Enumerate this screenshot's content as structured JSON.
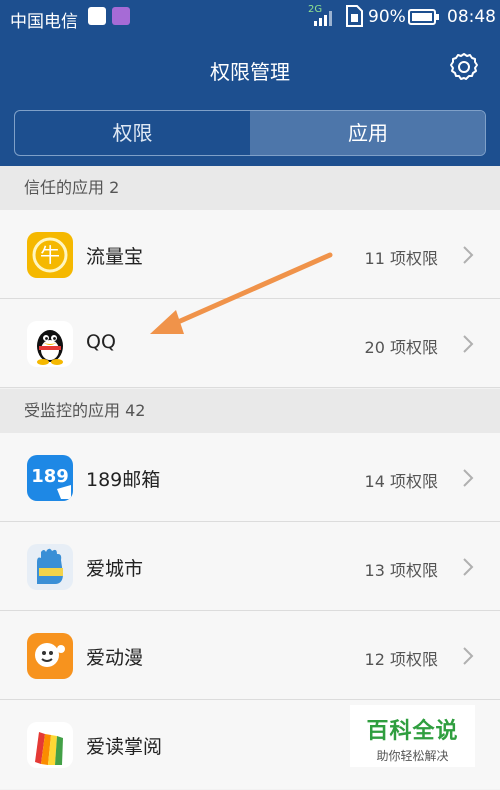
{
  "status_bar": {
    "carrier": "中国电信",
    "network": "2G",
    "battery": "90%",
    "time": "08:48"
  },
  "header": {
    "title": "权限管理",
    "tabs": [
      {
        "label": "权限",
        "active": false
      },
      {
        "label": "应用",
        "active": true
      }
    ]
  },
  "sections": {
    "trusted": {
      "title": "信任的应用 2",
      "apps": [
        {
          "name": "流量宝",
          "permissions": "11 项权限"
        },
        {
          "name": "QQ",
          "permissions": "20 项权限"
        }
      ]
    },
    "monitored": {
      "title": "受监控的应用 42",
      "apps": [
        {
          "name": "189邮箱",
          "permissions": "14 项权限"
        },
        {
          "name": "爱城市",
          "permissions": "13 项权限"
        },
        {
          "name": "爱动漫",
          "permissions": "12 项权限"
        },
        {
          "name": "爱读掌阅",
          "permissions": ""
        }
      ]
    }
  },
  "icons": {
    "liuliangbao": {
      "text": "牛",
      "color": "#f5b800"
    },
    "mail189": {
      "text": "189",
      "color": "#1e88e5"
    }
  },
  "watermark": {
    "title": "百科全说",
    "subtitle": "助你轻松解决"
  },
  "colors": {
    "header": "#1d4f8f",
    "tab_active": "#4d76aa",
    "arrow": "#f0934a"
  }
}
